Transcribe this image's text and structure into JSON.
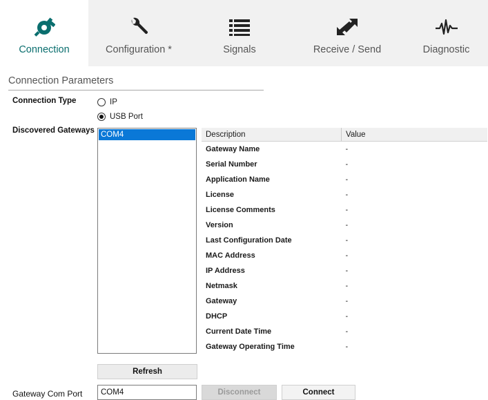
{
  "tabs": [
    {
      "id": "connection",
      "label": "Connection",
      "icon": "plug-icon",
      "active": true
    },
    {
      "id": "configuration",
      "label": "Configuration *",
      "icon": "wrench-icon",
      "active": false
    },
    {
      "id": "signals",
      "label": "Signals",
      "icon": "list-icon",
      "active": false
    },
    {
      "id": "receive_send",
      "label": "Receive / Send",
      "icon": "send-receive-arrows-icon",
      "active": false
    },
    {
      "id": "diagnostic",
      "label": "Diagnostic",
      "icon": "waveform-icon",
      "active": false
    }
  ],
  "colors": {
    "accent": "#0a6e6e",
    "selection": "#0a78d7",
    "tabbar": "#f1f1f1"
  },
  "section": {
    "title": "Connection Parameters"
  },
  "connection_type": {
    "label": "Connection Type",
    "options": [
      {
        "label": "IP",
        "selected": false
      },
      {
        "label": "USB Port",
        "selected": true
      }
    ]
  },
  "gateways": {
    "label": "Discovered Gateways",
    "items": [
      "COM4"
    ],
    "selected": "COM4"
  },
  "info_table": {
    "headers": [
      "Description",
      "Value"
    ],
    "rows": [
      [
        "Gateway Name",
        "-"
      ],
      [
        "Serial Number",
        "-"
      ],
      [
        "Application Name",
        "-"
      ],
      [
        "License",
        "-"
      ],
      [
        "License Comments",
        "-"
      ],
      [
        "Version",
        "-"
      ],
      [
        "Last Configuration Date",
        "-"
      ],
      [
        "MAC Address",
        "-"
      ],
      [
        "IP Address",
        "-"
      ],
      [
        "Netmask",
        "-"
      ],
      [
        "Gateway",
        "-"
      ],
      [
        "DHCP",
        "-"
      ],
      [
        "Current Date Time",
        "-"
      ],
      [
        "Gateway Operating Time",
        "-"
      ]
    ]
  },
  "buttons": {
    "refresh": "Refresh",
    "disconnect": "Disconnect",
    "connect": "Connect"
  },
  "com_port": {
    "label": "Gateway Com Port",
    "value": "COM4"
  }
}
